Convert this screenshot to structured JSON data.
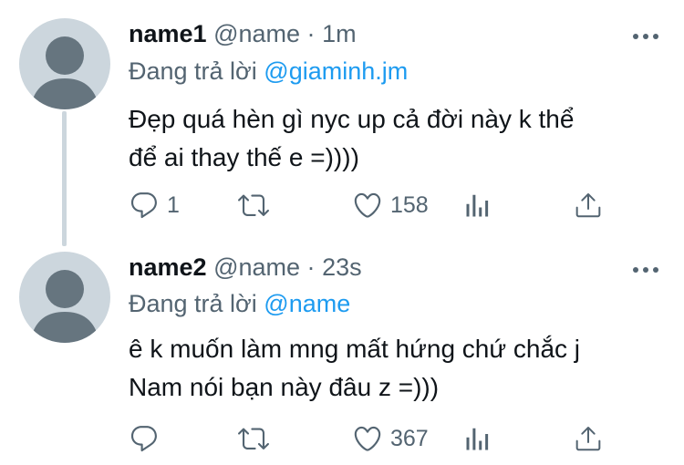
{
  "tweets": [
    {
      "name": "name1",
      "handle": "@name",
      "separator": "·",
      "time": "1m",
      "reply_prefix": "Đang trả lời",
      "reply_mention": "@giaminh.jm",
      "text_line1": "Đẹp quá hèn gì nyc up cả đời này k thể",
      "text_line2": "để ai thay thế e =))))",
      "reply_count": "1",
      "retweet_count": "",
      "like_count": "158"
    },
    {
      "name": "name2",
      "handle": "@name",
      "separator": "·",
      "time": "23s",
      "reply_prefix": "Đang trả lời",
      "reply_mention": "@name",
      "text_line1": "ê k muốn làm mng mất hứng chứ chắc j",
      "text_line2": "Nam nói bạn này đâu z =)))",
      "reply_count": "",
      "retweet_count": "",
      "like_count": "367"
    }
  ],
  "icons": {
    "more": "more-horizontal-icon",
    "reply": "reply-bubble-icon",
    "retweet": "retweet-icon",
    "like": "heart-icon",
    "analytics": "analytics-bars-icon",
    "share": "share-upload-icon"
  },
  "colors": {
    "text": "#0f1419",
    "secondary": "#536471",
    "mention": "#1d9bf0",
    "avatar_bg": "#ccd6dd",
    "avatar_fg": "#66757f"
  }
}
